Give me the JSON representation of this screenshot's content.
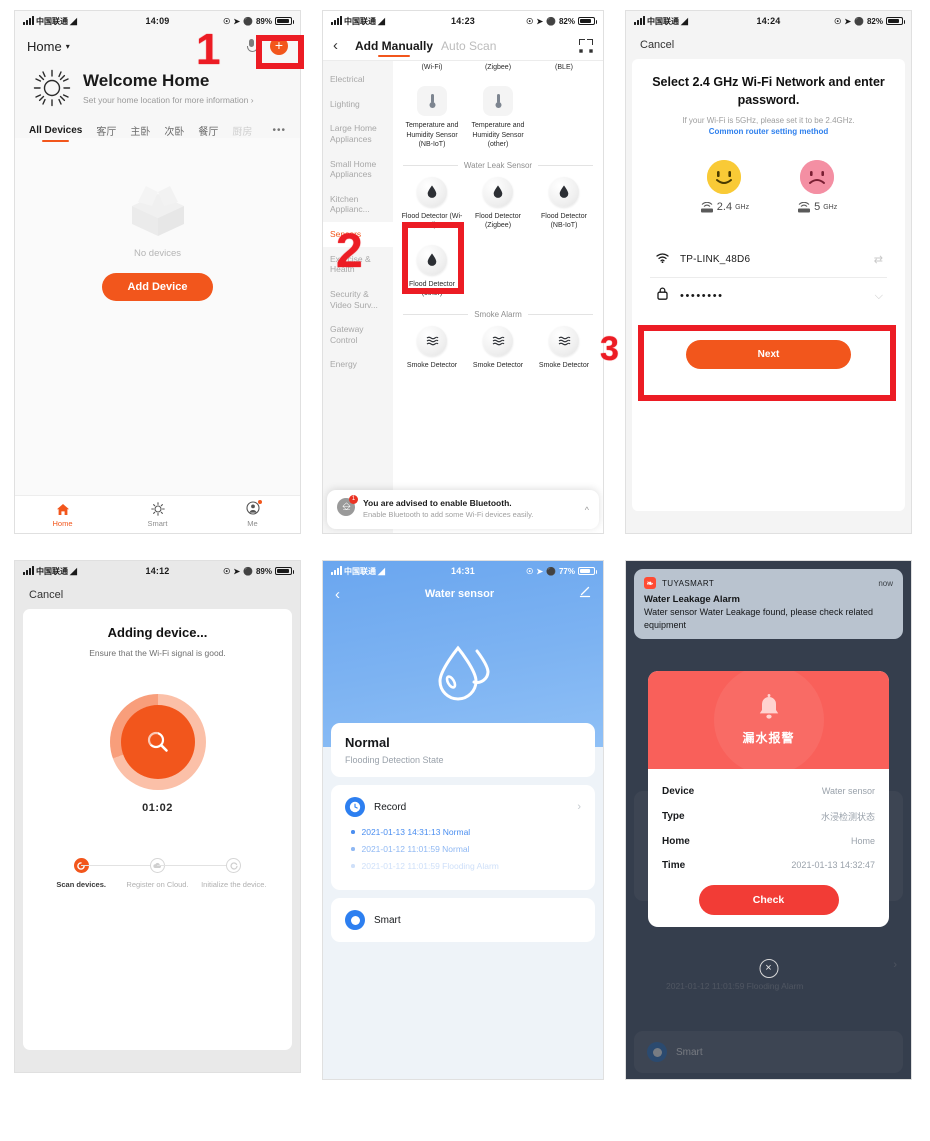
{
  "annotations": {
    "step1": "1",
    "step2": "2",
    "step3": "3"
  },
  "panel1": {
    "status": {
      "carrier": "中国联通",
      "time": "14:09",
      "battery": "89%"
    },
    "nav": {
      "home_label": "Home",
      "mic_icon": "mic-icon",
      "add_icon": "plus-icon"
    },
    "welcome": {
      "title": "Welcome Home",
      "subtitle": "Set your home location for more information",
      "chevron": "›"
    },
    "tabs": [
      "All Devices",
      "客厅",
      "主卧",
      "次卧",
      "餐厅",
      "厨房"
    ],
    "tabs_more": "•••",
    "empty": {
      "text": "No devices",
      "button": "Add Device"
    },
    "tabbar": [
      {
        "label": "Home",
        "icon": "home-icon",
        "active": true
      },
      {
        "label": "Smart",
        "icon": "smart-sun-icon",
        "active": false
      },
      {
        "label": "Me",
        "icon": "profile-icon",
        "active": false,
        "badge": true
      }
    ]
  },
  "panel2": {
    "status": {
      "carrier": "中国联通",
      "time": "14:23",
      "battery": "82%"
    },
    "nav": {
      "back": "‹",
      "tab_manual": "Add Manually",
      "tab_auto": "Auto Scan",
      "scan_icon": "scan-frame-icon"
    },
    "categories": [
      "Electrical",
      "Lighting",
      "Large Home Appliances",
      "Small Home Appliances",
      "Kitchen Applianc...",
      "Sensors",
      "Exercise & Health",
      "Security & Video Surv...",
      "Gateway Control",
      "Energy"
    ],
    "active_category": "Sensors",
    "top_partial_labels": [
      "(Wi-Fi)",
      "(Zigbee)",
      "(BLE)"
    ],
    "temp_devices": [
      "Temperature and Humidity Sensor (NB-IoT)",
      "Temperature and Humidity Sensor (other)"
    ],
    "section_water": "Water Leak Sensor",
    "water_devices": [
      "Flood Detector (Wi-Fi)",
      "Flood Detector (Zigbee)",
      "Flood Detector (NB-IoT)",
      "Flood Detector (other)"
    ],
    "section_smoke": "Smoke  Alarm",
    "smoke_devices": [
      "Smoke Detector",
      "Smoke Detector",
      "Smoke Detector"
    ],
    "bluetooth_banner": {
      "title": "You are advised to enable Bluetooth.",
      "body": "Enable Bluetooth to add some Wi-Fi devices easily.",
      "icon": "bluetooth-icon",
      "badge": "1",
      "chevron": "^"
    }
  },
  "panel3": {
    "status": {
      "carrier": "中国联通",
      "time": "14:24",
      "battery": "82%"
    },
    "cancel": "Cancel",
    "title": "Select 2.4 GHz Wi-Fi Network and enter password.",
    "subtitle": "If your Wi-Fi is 5GHz, please set it to be 2.4GHz.",
    "link": "Common router setting method",
    "bands": [
      {
        "label": "2.4",
        "unit": "GHz",
        "face": "happy",
        "color": "#f9ca36"
      },
      {
        "label": "5",
        "unit": "GHz",
        "face": "sad",
        "color": "#f48fa3"
      }
    ],
    "ssid": {
      "value": "TP-LINK_48D6",
      "icon": "wifi-icon",
      "action_icon": "switch-network-icon"
    },
    "password": {
      "value": "••••••••",
      "icon": "lock-icon",
      "action_icon": "eye-off-icon"
    },
    "next": "Next"
  },
  "panel4": {
    "status": {
      "carrier": "中国联通",
      "time": "14:12",
      "battery": "89%"
    },
    "cancel": "Cancel",
    "title": "Adding device...",
    "subtitle": "Ensure that the Wi-Fi signal is good.",
    "timer": "01:02",
    "scan_icon": "magnifier-icon",
    "steps": [
      {
        "label": "Scan devices.",
        "icon": "spinner-icon",
        "active": true
      },
      {
        "label": "Register on Cloud.",
        "icon": "cloud-icon",
        "active": false
      },
      {
        "label": "Initialize the device.",
        "icon": "refresh-icon",
        "active": false
      }
    ]
  },
  "panel5": {
    "status": {
      "carrier": "中国联通",
      "time": "14:31",
      "battery": "77%"
    },
    "nav": {
      "back": "‹",
      "title": "Water sensor",
      "edit_icon": "pencil-icon"
    },
    "hero_icon": "water-drop-icon",
    "state": {
      "value": "Normal",
      "label": "Flooding Detection State"
    },
    "record": {
      "label": "Record",
      "icon": "clock-icon",
      "chevron": "›",
      "items": [
        "2021-01-13 14:31:13 Normal",
        "2021-01-12 11:01:59 Normal",
        "2021-01-12 11:01:59 Flooding Alarm"
      ]
    },
    "smart": {
      "label": "Smart",
      "icon": "smart-toggle-icon"
    }
  },
  "panel6": {
    "notification": {
      "app": "TUYASMART",
      "time": "now",
      "title": "Water Leakage Alarm",
      "body": "Water sensor Water Leakage found, please check related equipment",
      "icon": "tuya-logo-icon"
    },
    "modal": {
      "header_cn": "漏水报警",
      "bell_icon": "bell-icon",
      "rows": [
        {
          "key": "Device",
          "value": "Water sensor"
        },
        {
          "key": "Type",
          "value": "水浸检测状态"
        },
        {
          "key": "Home",
          "value": "Home"
        },
        {
          "key": "Time",
          "value": "2021-01-13 14:32:47"
        }
      ],
      "button": "Check"
    },
    "close_icon": "close-x-icon",
    "bg_record": "2021-01-12 11:01:59 Flooding Alarm",
    "bg_smart": "Smart"
  },
  "colors": {
    "accent_orange": "#f2561c",
    "annotation_red": "#ec1c24",
    "blue": "#2d7ff0",
    "alarm_red": "#f9605a"
  }
}
